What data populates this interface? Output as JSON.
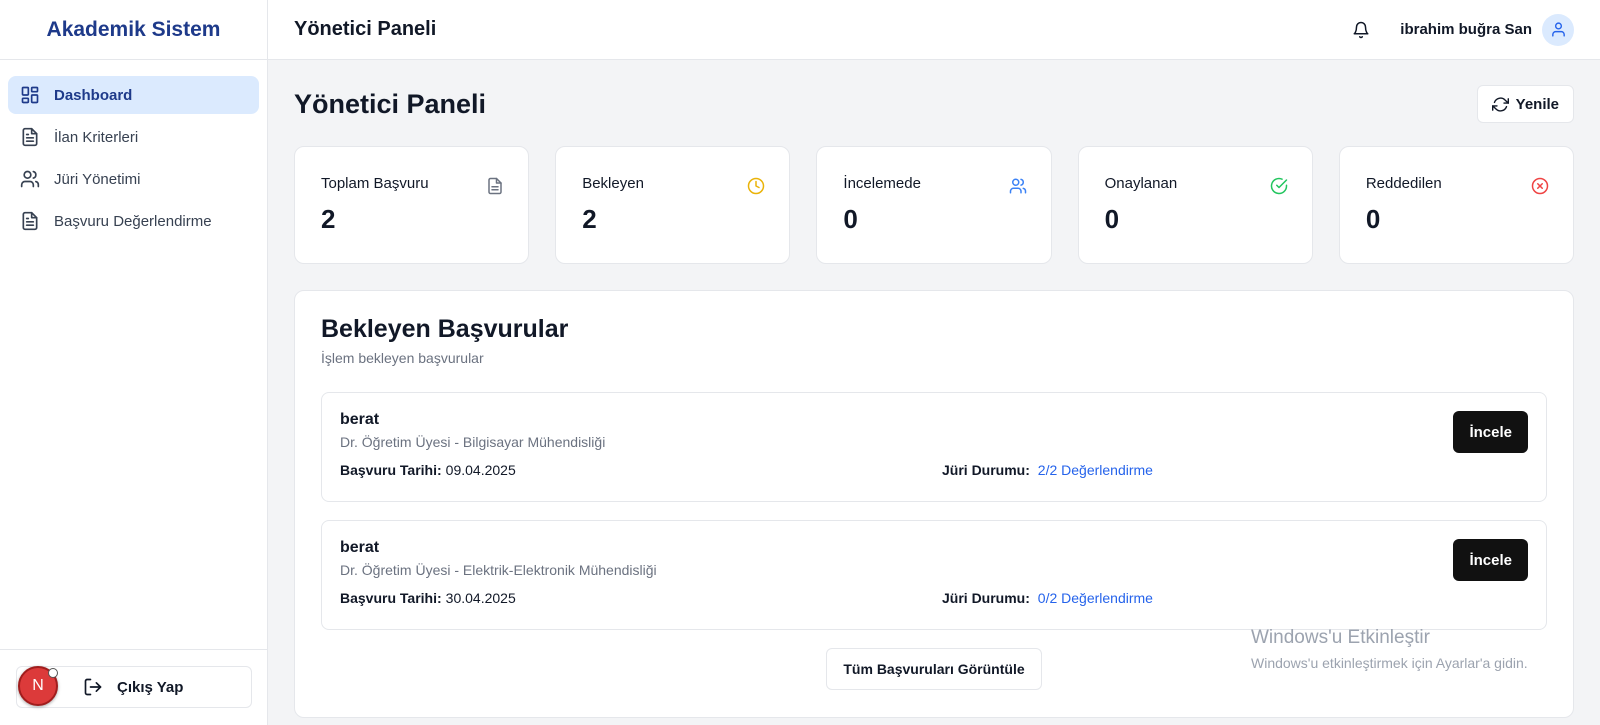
{
  "sidebar": {
    "brand": "Akademik Sistem",
    "items": [
      {
        "label": "Dashboard",
        "icon": "dashboard-grid-icon",
        "active": true
      },
      {
        "label": "İlan Kriterleri",
        "icon": "document-icon",
        "active": false
      },
      {
        "label": "Jüri Yönetimi",
        "icon": "users-icon",
        "active": false
      },
      {
        "label": "Başvuru Değerlendirme",
        "icon": "document-icon",
        "active": false
      }
    ],
    "logout_label": "Çıkış Yap",
    "badge_letter": "N"
  },
  "topbar": {
    "title": "Yönetici Paneli",
    "user_name": "ibrahim buğra San"
  },
  "main": {
    "page_title": "Yönetici Paneli",
    "refresh_label": "Yenile",
    "stats": [
      {
        "label": "Toplam Başvuru",
        "value": "2",
        "icon": "file-icon",
        "color": "#6b7280"
      },
      {
        "label": "Bekleyen",
        "value": "2",
        "icon": "clock-icon",
        "color": "#eab308"
      },
      {
        "label": "İncelemede",
        "value": "0",
        "icon": "users-icon",
        "color": "#3b82f6"
      },
      {
        "label": "Onaylanan",
        "value": "0",
        "icon": "check-circle-icon",
        "color": "#22c55e"
      },
      {
        "label": "Reddedilen",
        "value": "0",
        "icon": "x-circle-icon",
        "color": "#ef4444"
      }
    ],
    "pending": {
      "title": "Bekleyen Başvurular",
      "subtitle": "İşlem bekleyen başvurular",
      "date_label": "Başvuru Tarihi:",
      "jury_label": "Jüri Durumu:",
      "inspect_label": "İncele",
      "items": [
        {
          "name": "berat",
          "position": "Dr. Öğretim Üyesi - Bilgisayar Mühendisliği",
          "date": "09.04.2025",
          "jury": "2/2 Değerlendirme"
        },
        {
          "name": "berat",
          "position": "Dr. Öğretim Üyesi - Elektrik-Elektronik Mühendisliği",
          "date": "30.04.2025",
          "jury": "0/2 Değerlendirme"
        }
      ],
      "view_all_label": "Tüm Başvuruları Görüntüle"
    }
  },
  "watermark": {
    "line1": "Windows'u Etkinleştir",
    "line2": "Windows'u etkinleştirmek için Ayarlar'a gidin."
  },
  "colors": {
    "accent": "#1e3a8a",
    "active_bg": "#dbeafe",
    "link": "#2563eb",
    "primary_button": "#111111"
  }
}
